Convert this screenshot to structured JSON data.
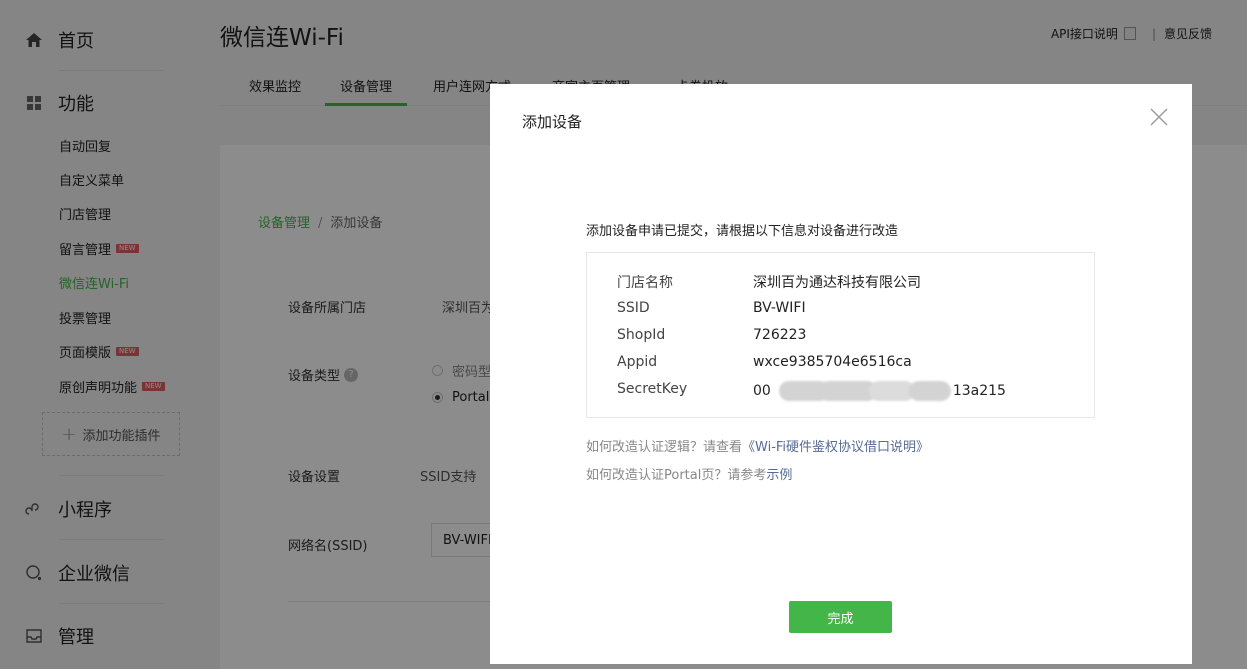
{
  "sidebar": {
    "home": "首页",
    "features": "功能",
    "items": [
      {
        "label": "自动回复",
        "new": false,
        "active": false
      },
      {
        "label": "自定义菜单",
        "new": false,
        "active": false
      },
      {
        "label": "门店管理",
        "new": false,
        "active": false
      },
      {
        "label": "留言管理",
        "new": true,
        "active": false
      },
      {
        "label": "微信连Wi-Fi",
        "new": false,
        "active": true
      },
      {
        "label": "投票管理",
        "new": false,
        "active": false
      },
      {
        "label": "页面模版",
        "new": true,
        "active": false
      },
      {
        "label": "原创声明功能",
        "new": true,
        "active": false
      }
    ],
    "new_badge": "NEW",
    "add_plugin": "添加功能插件",
    "mini_program": "小程序",
    "enterprise_wechat": "企业微信",
    "manage": "管理"
  },
  "header": {
    "title": "微信连Wi-Fi",
    "api_doc": "API接口说明",
    "feedback": "意见反馈",
    "separator": "|"
  },
  "tabs": [
    {
      "label": "效果监控",
      "active": false
    },
    {
      "label": "设备管理",
      "active": true
    },
    {
      "label": "用户连网方式",
      "active": false
    },
    {
      "label": "商家主页管理",
      "active": false
    },
    {
      "label": "卡券投放",
      "active": false
    }
  ],
  "breadcrumb": {
    "parent": "设备管理",
    "sep": "/",
    "current": "添加设备"
  },
  "form": {
    "store_label": "设备所属门店",
    "store_value": "深圳百为",
    "type_label": "设备类型",
    "type_option1": "密码型",
    "type_option2": "Portal",
    "settings_label": "设备设置",
    "settings_value": "SSID支持",
    "ssid_label": "网络名(SSID)",
    "ssid_value": "BV-WIFI"
  },
  "modal": {
    "title": "添加设备",
    "message": "添加设备申请已提交，请根据以下信息对设备进行改造",
    "rows": [
      {
        "key": "门店名称",
        "value": "深圳百为通达科技有限公司"
      },
      {
        "key": "SSID",
        "value": "BV-WIFI"
      },
      {
        "key": "ShopId",
        "value": "726223"
      },
      {
        "key": "Appid",
        "value": "wxce9385704e6516ca"
      }
    ],
    "secret_key_label": "SecretKey",
    "secret_key_prefix": "00",
    "secret_key_suffix": "13a215",
    "help1_text": "如何改造认证逻辑？请查看",
    "help1_link": "《Wi-Fi硬件鉴权协议借口说明》",
    "help2_text": "如何改造认证Portal页？请参考",
    "help2_link": "示例",
    "done": "完成"
  },
  "colors": {
    "accent": "#44b549",
    "link": "#576b95",
    "badge": "#e15f63"
  }
}
